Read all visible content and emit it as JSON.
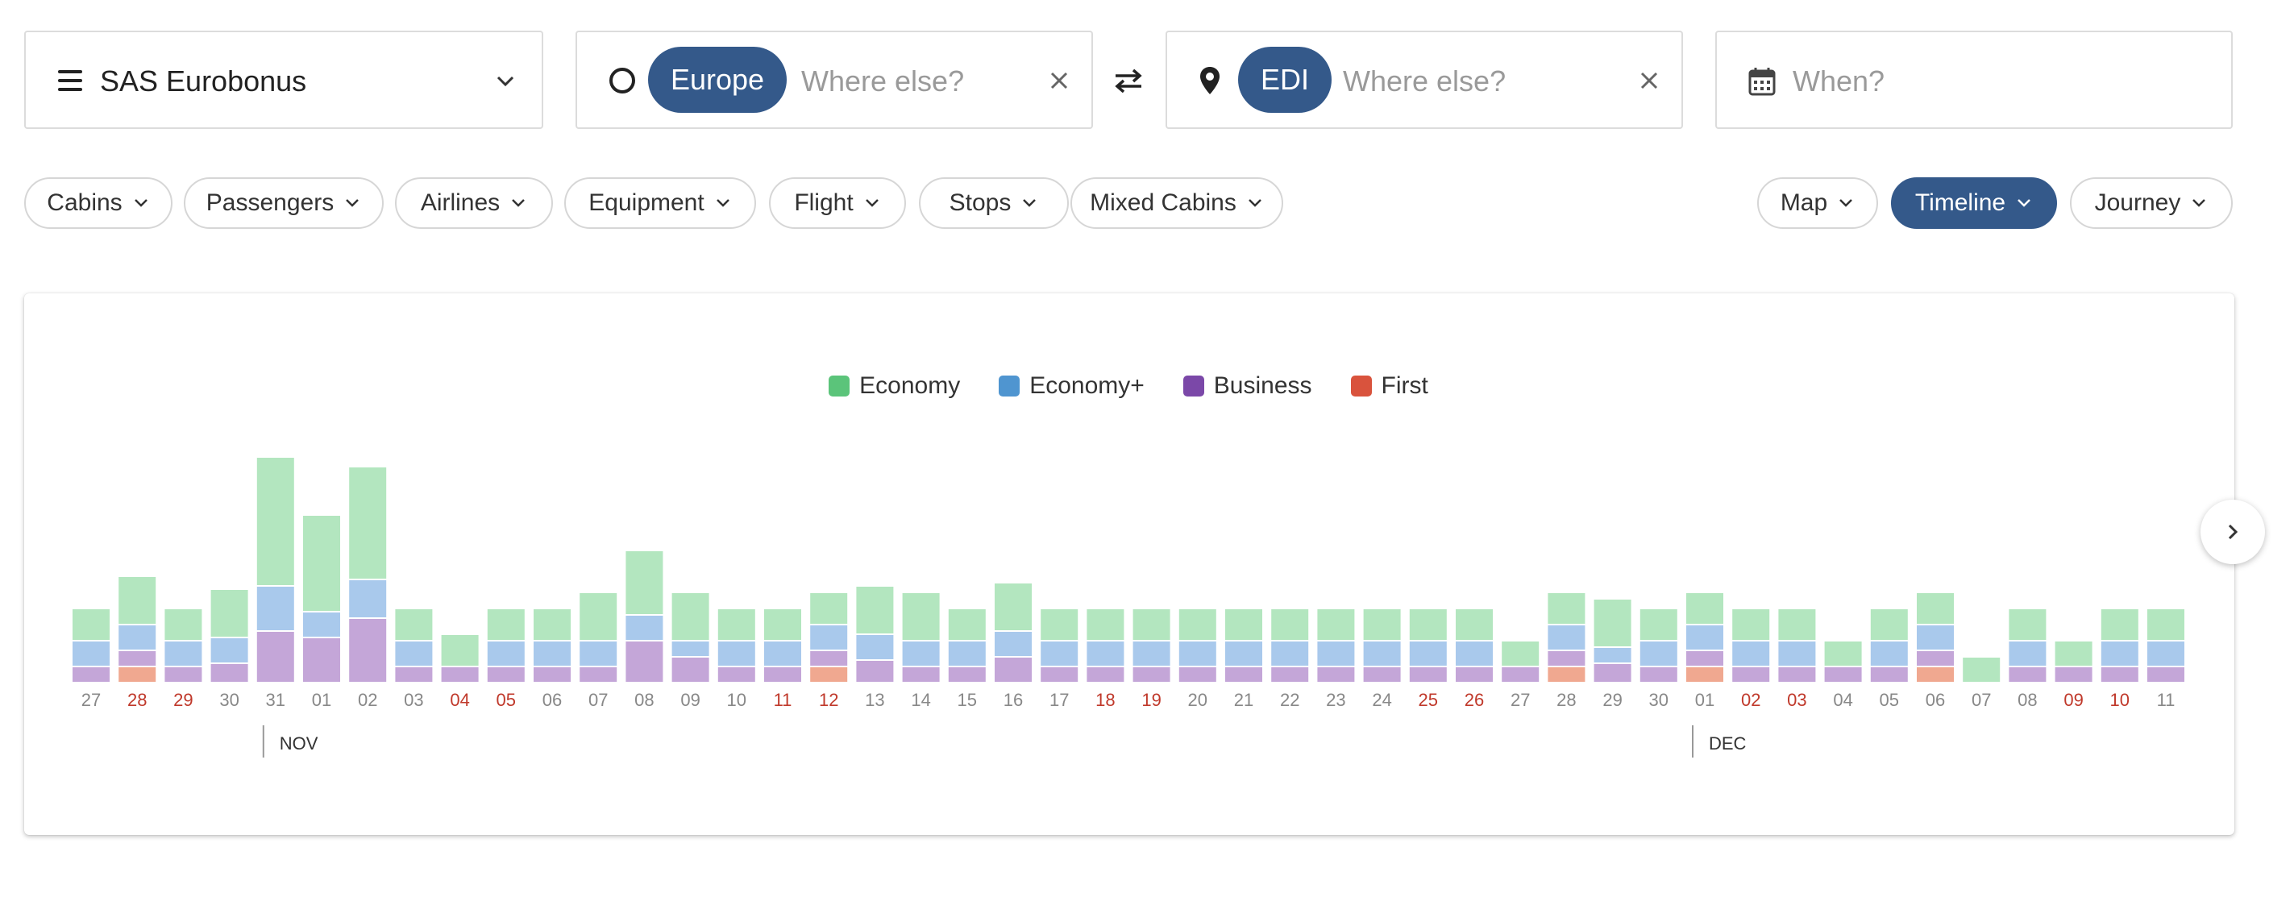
{
  "program": {
    "label": "SAS Eurobonus"
  },
  "origin": {
    "chip": "Europe",
    "placeholder": "Where else?"
  },
  "destination": {
    "chip": "EDI",
    "placeholder": "Where else?"
  },
  "date": {
    "placeholder": "When?"
  },
  "filters": [
    "Cabins",
    "Passengers",
    "Airlines",
    "Equipment",
    "Flight",
    "Stops",
    "Mixed Cabins"
  ],
  "views": {
    "map": "Map",
    "timeline": "Timeline",
    "journey": "Journey"
  },
  "legend": [
    {
      "name": "Economy",
      "color": "#5bc47a"
    },
    {
      "name": "Economy+",
      "color": "#4f95d0"
    },
    {
      "name": "Business",
      "color": "#7b48a8"
    },
    {
      "name": "First",
      "color": "#d9533d"
    }
  ],
  "colors": {
    "accent": "#34598a",
    "weekend_label": "#c0392b",
    "weekday_label": "#888888"
  },
  "chart_data": {
    "type": "bar",
    "stacked": true,
    "categories": [
      "27",
      "28",
      "29",
      "30",
      "31",
      "01",
      "02",
      "03",
      "04",
      "05",
      "06",
      "07",
      "08",
      "09",
      "10",
      "11",
      "12",
      "13",
      "14",
      "15",
      "16",
      "17",
      "18",
      "19",
      "20",
      "21",
      "22",
      "23",
      "24",
      "25",
      "26",
      "27",
      "28",
      "29",
      "30",
      "01",
      "02",
      "03",
      "04",
      "05",
      "06",
      "07",
      "08",
      "09",
      "10",
      "11"
    ],
    "weekend": [
      false,
      true,
      true,
      false,
      false,
      false,
      false,
      false,
      true,
      true,
      false,
      false,
      false,
      false,
      false,
      true,
      true,
      false,
      false,
      false,
      false,
      false,
      true,
      true,
      false,
      false,
      false,
      false,
      false,
      true,
      true,
      false,
      false,
      false,
      false,
      false,
      true,
      true,
      false,
      false,
      false,
      false,
      false,
      true,
      true,
      false
    ],
    "series": [
      {
        "name": "Economy",
        "values": [
          1,
          1.5,
          1,
          1.5,
          4,
          3,
          3.5,
          1,
          1,
          1,
          1,
          1.5,
          2,
          1.5,
          1,
          1,
          1,
          1.5,
          1.5,
          1,
          1.5,
          1,
          1,
          1,
          1,
          1,
          1,
          1,
          1,
          1,
          1,
          0.8,
          1,
          1.5,
          1,
          1,
          1,
          1,
          0.8,
          1,
          1,
          0.8,
          1,
          0.8,
          1,
          1
        ]
      },
      {
        "name": "Economy+",
        "values": [
          0.8,
          0.8,
          0.8,
          0.8,
          1.4,
          0.8,
          1.2,
          0.8,
          0,
          0.8,
          0.8,
          0.8,
          0.8,
          0.5,
          0.8,
          0.8,
          0.8,
          0.8,
          0.8,
          0.8,
          0.8,
          0.8,
          0.8,
          0.8,
          0.8,
          0.8,
          0.8,
          0.8,
          0.8,
          0.8,
          0.8,
          0,
          0.8,
          0.5,
          0.8,
          0.8,
          0.8,
          0.8,
          0,
          0.8,
          0.8,
          0,
          0.8,
          0,
          0.8,
          0.8
        ]
      },
      {
        "name": "Business",
        "values": [
          0.5,
          0.5,
          0.5,
          0.6,
          1.6,
          1.4,
          2.0,
          0.5,
          0.5,
          0.5,
          0.5,
          0.5,
          1.3,
          0.8,
          0.5,
          0.5,
          0.5,
          0.7,
          0.5,
          0.5,
          0.8,
          0.5,
          0.5,
          0.5,
          0.5,
          0.5,
          0.5,
          0.5,
          0.5,
          0.5,
          0.5,
          0.5,
          0.5,
          0.6,
          0.5,
          0.5,
          0.5,
          0.5,
          0.5,
          0.5,
          0.5,
          0,
          0.5,
          0.5,
          0.5,
          0.5
        ]
      },
      {
        "name": "First",
        "values": [
          0,
          0.5,
          0,
          0,
          0,
          0,
          0,
          0,
          0,
          0,
          0,
          0,
          0,
          0,
          0,
          0,
          0.5,
          0,
          0,
          0,
          0,
          0,
          0,
          0,
          0,
          0,
          0,
          0,
          0,
          0,
          0,
          0,
          0.5,
          0,
          0,
          0.5,
          0,
          0,
          0,
          0,
          0.5,
          0,
          0,
          0,
          0,
          0
        ]
      }
    ],
    "months": [
      {
        "label": "NOV",
        "index": 4
      },
      {
        "label": "DEC",
        "index": 35
      }
    ],
    "ylim": [
      0,
      7
    ]
  }
}
